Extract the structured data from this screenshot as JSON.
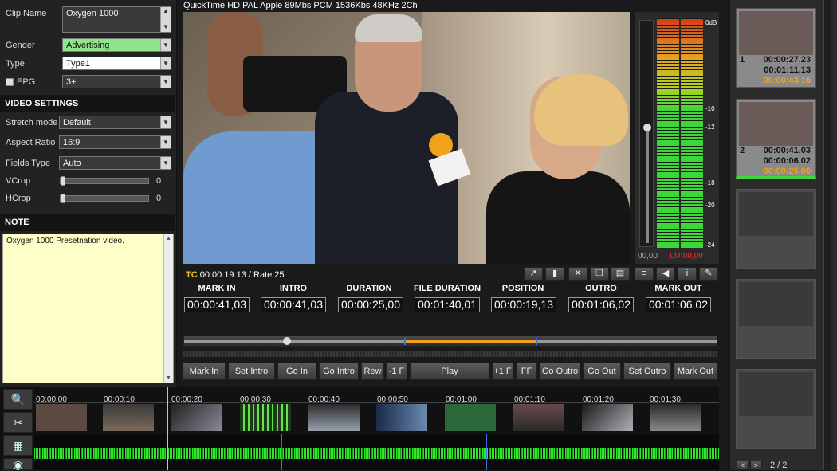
{
  "clip": {
    "name_label": "Clip Name",
    "name_value": "Oxygen 1000",
    "gender_label": "Gender",
    "gender_value": "Advertising",
    "type_label": "Type",
    "type_value": "Type1",
    "epg_label": "EPG",
    "epg_value": "3+"
  },
  "video_settings": {
    "header": "VIDEO SETTINGS",
    "stretch_label": "Stretch mode",
    "stretch_value": "Default",
    "aspect_label": "Aspect Ratio",
    "aspect_value": "16:9",
    "fields_label": "Fields Type",
    "fields_value": "Auto",
    "vcrop_label": "VCrop",
    "vcrop_value": "0",
    "hcrop_label": "HCrop",
    "hcrop_value": "0"
  },
  "note": {
    "header": "NOTE",
    "text": "Oxygen 1000 Presetnation video."
  },
  "media_info": "QuickTime HD PAL  Apple 89Mbs PCM 1536Kbs 48KHz 2Ch",
  "tc": {
    "label": "TC",
    "value": "00:00:19:13 / Rate 25"
  },
  "meter": {
    "scale": [
      "0dB",
      "-10",
      "-12",
      "-18",
      "-20",
      "-24"
    ],
    "left_readout": "00,00",
    "right_readout": "LU:00,00"
  },
  "timecodes": [
    {
      "header": "MARK IN",
      "value": "00:00:41,03"
    },
    {
      "header": "INTRO",
      "value": "00:00:41,03"
    },
    {
      "header": "DURATION",
      "value": "00:00:25,00"
    },
    {
      "header": "FILE DURATION",
      "value": "00:01:40,01"
    },
    {
      "header": "POSITION",
      "value": "00:00:19,13"
    },
    {
      "header": "OUTRO",
      "value": "00:01:06,02"
    },
    {
      "header": "MARK OUT",
      "value": "00:01:06,02"
    }
  ],
  "transport": [
    "Mark In",
    "Set Intro",
    "Go In",
    "Go Intro",
    "Rew",
    "-1 F",
    "Play",
    "+1 F",
    "FF",
    "Go Outro",
    "Go Out",
    "Set Outro",
    "Mark Out"
  ],
  "timeline_ticks": [
    "00:00:00",
    "00:00:10",
    "00:00:20",
    "00:00:30",
    "00:00:40",
    "00:00:50",
    "00:01:00",
    "00:01:10",
    "00:01:20",
    "00:01:30"
  ],
  "playlist": [
    {
      "index": "1",
      "t1": "00:00:27,23",
      "t2": "00:01:11,13",
      "t3": "00:00:43,16"
    },
    {
      "index": "2",
      "t1": "00:00:41,03",
      "t2": "00:00:06,02",
      "t3": "00:00:25,00"
    }
  ],
  "pager": "2 / 2",
  "colors": {
    "accent": "#f0a020",
    "meter_green": "#3fd63a",
    "waveform": "#2fe82a",
    "note_bg": "#fefec8"
  }
}
